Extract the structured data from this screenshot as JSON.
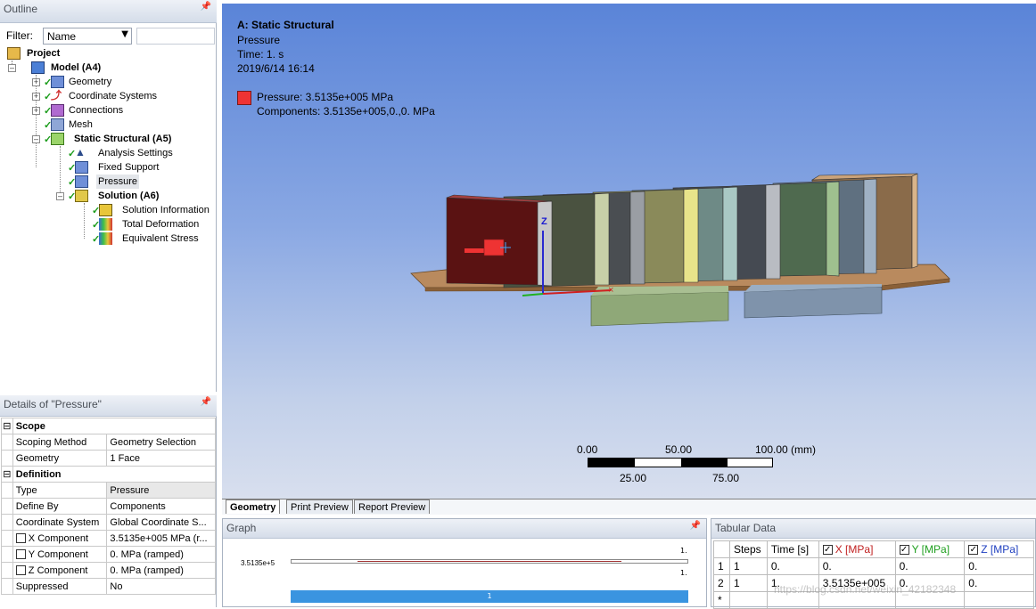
{
  "outline": {
    "title": "Outline",
    "filter_label": "Filter:",
    "filter_value": "Name",
    "tree": {
      "project": "Project",
      "model": "Model (A4)",
      "geometry": "Geometry",
      "coordinate_systems": "Coordinate Systems",
      "connections": "Connections",
      "mesh": "Mesh",
      "static_structural": "Static Structural (A5)",
      "analysis_settings": "Analysis Settings",
      "fixed_support": "Fixed Support",
      "pressure": "Pressure",
      "solution": "Solution (A6)",
      "solution_information": "Solution Information",
      "total_deformation": "Total Deformation",
      "equivalent_stress": "Equivalent Stress"
    }
  },
  "details": {
    "title": "Details of \"Pressure\"",
    "scope_label": "Scope",
    "scoping_method_label": "Scoping Method",
    "scoping_method_value": "Geometry Selection",
    "geometry_label": "Geometry",
    "geometry_value": "1 Face",
    "definition_label": "Definition",
    "type_label": "Type",
    "type_value": "Pressure",
    "define_by_label": "Define By",
    "define_by_value": "Components",
    "coord_label": "Coordinate System",
    "coord_value": "Global Coordinate S...",
    "x_label": "X Component",
    "x_value": "3.5135e+005 MPa  (r...",
    "y_label": "Y Component",
    "y_value": "0. MPa  (ramped)",
    "z_label": "Z Component",
    "z_value": "0. MPa  (ramped)",
    "suppressed_label": "Suppressed",
    "suppressed_value": "No"
  },
  "viewport": {
    "title": "A: Static Structural",
    "subtitle": "Pressure",
    "time": "Time: 1. s",
    "date": "2019/6/14 16:14",
    "legend_name": "Pressure: 3.5135e+005 MPa",
    "legend_components": "Components: 3.5135e+005,0.,0. MPa",
    "legend_color": "#ee3333",
    "scale_0": "0.00",
    "scale_50": "50.00",
    "scale_100": "100.00 (mm)",
    "scale_25": "25.00",
    "scale_75": "75.00",
    "axis_z": "Z"
  },
  "tabs": [
    "Geometry",
    "Print Preview",
    "Report Preview"
  ],
  "graph": {
    "title": "Graph",
    "y_value": "3.5135e+5",
    "x_top": "1.",
    "x_bottom": "1.",
    "step_label": "1"
  },
  "tabular": {
    "title": "Tabular Data",
    "headers": [
      "Steps",
      "Time [s]",
      "X [MPa]",
      "Y [MPa]",
      "Z [MPa]"
    ],
    "rows": [
      {
        "index": "1",
        "steps": "1",
        "time": "0.",
        "x": "0.",
        "y": "0.",
        "z": "0."
      },
      {
        "index": "2",
        "steps": "1",
        "time": "1.",
        "x": "3.5135e+005",
        "y": "0.",
        "z": "0."
      }
    ],
    "new_row_marker": "*",
    "watermark": "https://blog.csdn.net/weixin_42182348"
  }
}
